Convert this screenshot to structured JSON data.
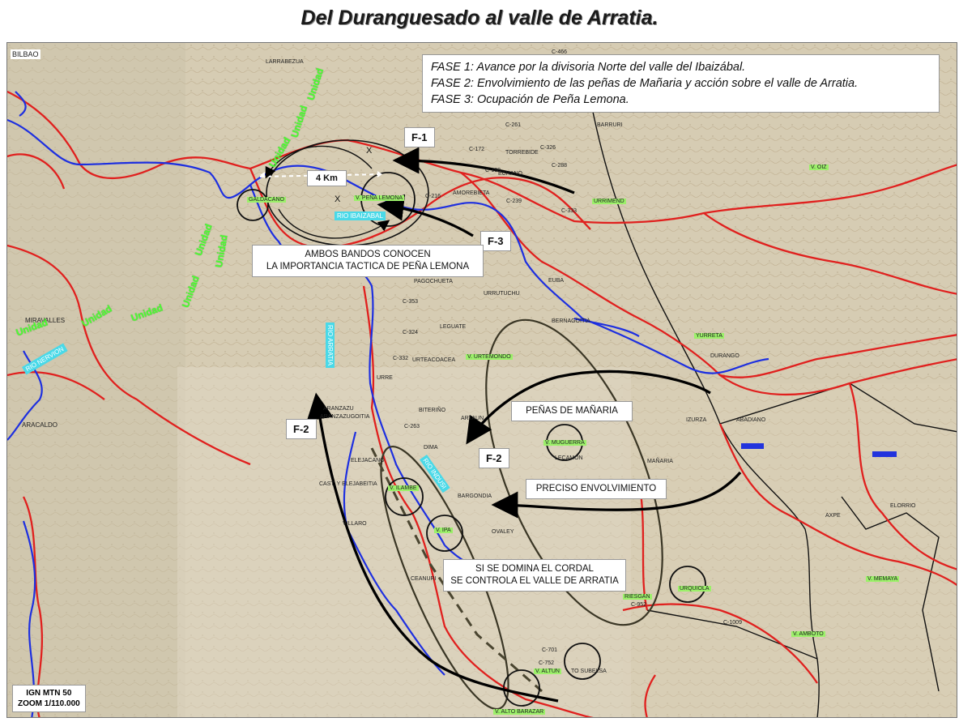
{
  "title": "Del Duranguesado al valle de Arratia.",
  "phases": [
    "FASE 1: Avance por la divisoria Norte del valle del Ibaizábal.",
    "FASE 2: Envolvimiento de las peñas de Mañaria y acción sobre el valle de Arratia.",
    "FASE 3: Ocupación de Peña Lemona."
  ],
  "labels": {
    "f1": "F-1",
    "f2a": "F-2",
    "f2b": "F-2",
    "f3": "F-3",
    "distance": "4 Km",
    "x1": "X",
    "x2": "X",
    "ambos_line1": "AMBOS BANDOS CONOCEN",
    "ambos_line2": "LA IMPORTANCIA TACTICA DE PEÑA LEMONA",
    "penas": "PEÑAS DE MAÑARIA",
    "preciso": "PRECISO ENVOLVIMIENTO",
    "cordal_line1": "SI SE DOMINA EL CORDAL",
    "cordal_line2": "SE CONTROLA EL VALLE DE ARRATIA"
  },
  "ign": {
    "line1": "IGN MTN 50",
    "line2": "ZOOM 1/110.000"
  },
  "places": {
    "bilbao": "BILBAO",
    "larrabezua": "LARRABEZUA",
    "galdacano": "GALDACANO",
    "pena_lemona": "V. PEÑA LEMONA",
    "amorebieta": "AMOREBIETA",
    "barruri": "BARRURI",
    "torrebide": "TORREBIDE",
    "echano": "ECHANO",
    "urrimend": "URRIMEND",
    "v_oiz": "V. OIZ",
    "pagochueta": "PAGOCHUETA",
    "urrutuchu": "URRUTUCHU",
    "euba": "EUBA",
    "leguate": "LEGUATE",
    "bernagoitia": "BERNAGOITIA",
    "yurreta": "YURRETA",
    "durango": "DURANGO",
    "urteacoa": "URTEACOACEA",
    "urtemondo": "V. URTEMONDO",
    "miravalles": "MIRAVALLES",
    "aracaldo": "ARACALDO",
    "aranzazu": "ARANZAZU",
    "aranzazugoitia": "ARANZAZUGOITIA",
    "biteri": "BITERIÑO",
    "artaun": "ARTAUN",
    "dima": "DIMA",
    "izurza": "IZURZA",
    "abadiano": "ABADIANO",
    "muguerra": "V. MUGUERRA",
    "lecamon": "LECAMON",
    "manaria": "MAÑARIA",
    "elejacano": "ELEJACANO",
    "castillo": "CAST. Y ELEJABEITIA",
    "ilamba": "V. ILAMBE",
    "bargondia": "BARGONDIA",
    "v_ipa": "V. IPA",
    "ovaley": "OVALEY",
    "villaro": "VILLARO",
    "elorrio": "ELORRIO",
    "axpe": "AXPE",
    "ceanuri": "CEANURI",
    "urquiola": "URQUIOLA",
    "riesgan": "RIESGAN",
    "amboto": "V. AMBOTO",
    "memaya": "V. MEMAYA",
    "altun": "V. ALTUN",
    "saibi": "TO SUBELSA",
    "alto": "V. ALTO BARAZAR",
    "c466": "C-466",
    "c261": "C-261",
    "c172": "C-172",
    "c326": "C-326",
    "c288": "C-288",
    "c180": "C-180",
    "c216": "C-216",
    "c239": "C-239",
    "c333": "C-333",
    "c353": "C-353",
    "c324": "C-324",
    "c332": "C-332",
    "c263": "C-263",
    "c1009": "C-1009",
    "c701": "C-701",
    "c752": "C-752",
    "c952": "C-952",
    "urre": "URRE"
  },
  "rivers": {
    "ibaizabal": "RIO IBAIZABAL",
    "arratia": "RIO ARRATIA",
    "dima_r": "RIO INDUSI",
    "nervion": "RIO NERVION"
  },
  "sectors": [
    "Unidad",
    "Unidad",
    "Unidad",
    "Unidad",
    "Unidad",
    "Unidad",
    "Unidad",
    "Unidad",
    "Unidad"
  ],
  "colors": {
    "road_red": "#e0201e",
    "river_blue": "#1d2fe0",
    "border_black": "#111111",
    "ellipse": "#3a3625",
    "unit_green": "#4cff33",
    "river_label": "#4ad9e8"
  }
}
